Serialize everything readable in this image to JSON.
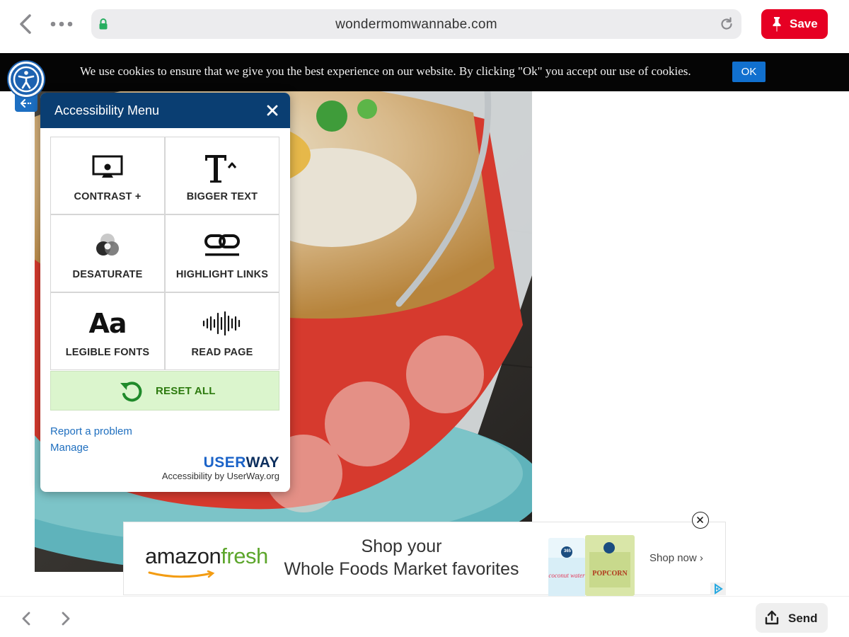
{
  "browser": {
    "url": "wondermomwannabe.com",
    "save_label": "Save",
    "send_label": "Send"
  },
  "cookie_banner": {
    "text": "We use cookies to ensure that we give you the best experience on our website. By clicking \"Ok\" you accept our use of cookies.",
    "ok_label": "OK"
  },
  "accessibility_menu": {
    "title": "Accessibility Menu",
    "tiles": [
      {
        "label": "CONTRAST +",
        "icon": "monitor-icon"
      },
      {
        "label": "BIGGER TEXT",
        "icon": "text-size-icon"
      },
      {
        "label": "DESATURATE",
        "icon": "desaturate-icon"
      },
      {
        "label": "HIGHLIGHT LINKS",
        "icon": "link-icon"
      },
      {
        "label": "LEGIBLE FONTS",
        "icon": "font-icon"
      },
      {
        "label": "READ PAGE",
        "icon": "sound-wave-icon"
      }
    ],
    "reset_label": "RESET ALL",
    "report_link": "Report a problem",
    "manage_link": "Manage",
    "brand_user": "USER",
    "brand_way": "WAY",
    "brand_sub": "Accessibility by UserWay.org"
  },
  "ad": {
    "brand_amazon": "amazon",
    "brand_fresh": "fresh",
    "headline_1": "Shop your",
    "headline_2": "Whole Foods Market favorites",
    "cta": "Shop now ›",
    "product_1": "coconut water",
    "product_2": "POPCORN",
    "product_brand": "365"
  },
  "colors": {
    "save_red": "#e60023",
    "panel_header": "#0a3e72",
    "link_blue": "#1f6fbf",
    "reset_green": "#2d7a0f",
    "cookie_ok": "#1170cf"
  }
}
